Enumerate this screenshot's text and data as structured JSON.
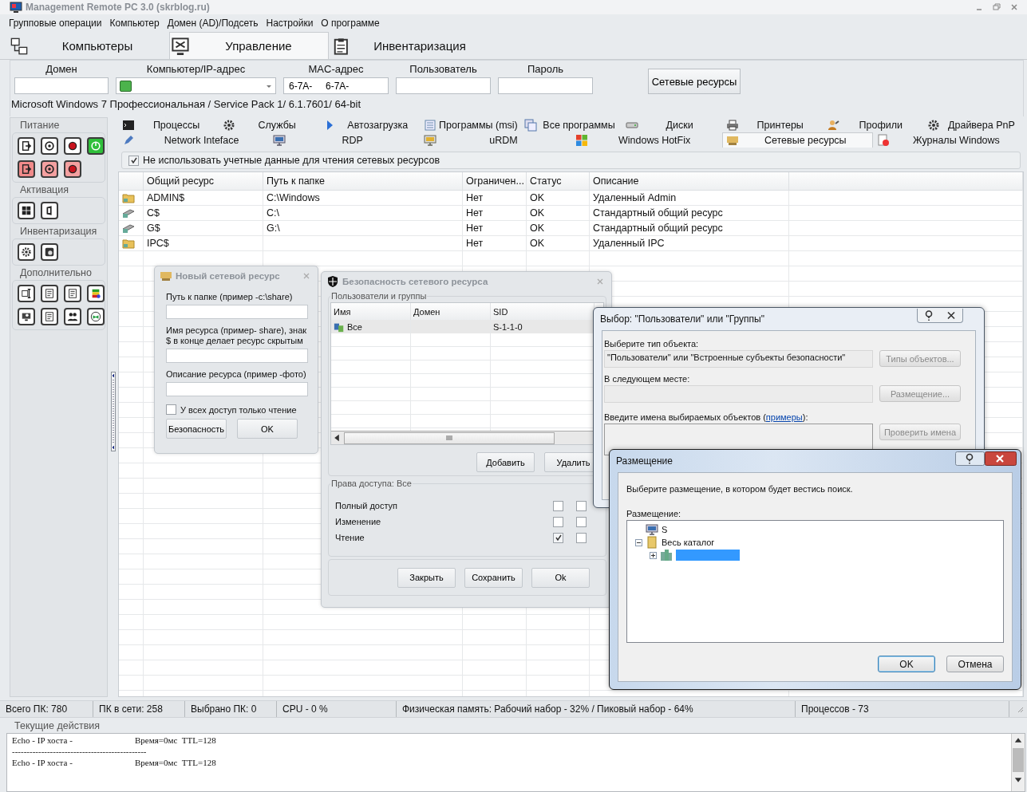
{
  "window": {
    "title": "Management Remote PC 3.0 (skrblog.ru)"
  },
  "menu": [
    "Групповые операции",
    "Компьютер",
    "Домен (AD)/Подсеть",
    "Настройки",
    "О программе"
  ],
  "main_tabs": [
    {
      "label": "Компьютеры",
      "selected": false
    },
    {
      "label": "Управление",
      "selected": true
    },
    {
      "label": "Инвентаризация",
      "selected": false
    }
  ],
  "connection": {
    "fields": [
      {
        "label": "Домен",
        "kind": "text"
      },
      {
        "label": "Компьютер/IP-адрес",
        "kind": "combo"
      },
      {
        "label": "MAC-адрес",
        "kind": "text",
        "value": "6-7A-     6-7A-"
      },
      {
        "label": "Пользователь",
        "kind": "text"
      },
      {
        "label": "Пароль",
        "kind": "text"
      }
    ],
    "button": "Сетевые ресурсы",
    "os_info": "Microsoft Windows 7 Профессиональная / Service Pack 1/ 6.1.7601/ 64-bit"
  },
  "sidebar": [
    {
      "title": "Питание"
    },
    {
      "title": "Активация"
    },
    {
      "title": "Инвентаризация"
    },
    {
      "title": "Дополнительно"
    }
  ],
  "sub_tabs": [
    [
      {
        "label": "Процессы",
        "selected": false
      },
      {
        "label": "Службы",
        "selected": false
      },
      {
        "label": "Автозагрузка",
        "selected": false
      },
      {
        "label": "Программы (msi)",
        "selected": false
      },
      {
        "label": "Все программы",
        "selected": false
      },
      {
        "label": "Диски",
        "selected": false
      },
      {
        "label": "Принтеры",
        "selected": false
      },
      {
        "label": "Профили",
        "selected": false
      },
      {
        "label": "Драйвера PnP",
        "selected": false
      }
    ],
    [
      {
        "label": "Network Inteface",
        "selected": false
      },
      {
        "label": "RDP",
        "selected": false
      },
      {
        "label": "uRDM",
        "selected": false
      },
      {
        "label": "Windows HotFix",
        "selected": false
      },
      {
        "label": "Сетевые ресурсы",
        "selected": true
      },
      {
        "label": "Журналы Windows",
        "selected": false
      }
    ]
  ],
  "option": {
    "label": "Не использовать учетные данные для чтения сетевых ресурсов",
    "checked": true
  },
  "table": {
    "columns": [
      "Общий ресурс",
      "Путь к папке",
      "Ограничен...",
      "Статус",
      "Описание"
    ],
    "rows": [
      {
        "kind": "folder",
        "share": "ADMIN$",
        "path": "C:\\Windows",
        "limit": "Нет",
        "status": "OK",
        "description": "Удаленный Admin"
      },
      {
        "kind": "drive",
        "share": "C$",
        "path": "C:\\",
        "limit": "Нет",
        "status": "OK",
        "description": "Стандартный общий ресурс"
      },
      {
        "kind": "drive",
        "share": "G$",
        "path": "G:\\",
        "limit": "Нет",
        "status": "OK",
        "description": "Стандартный общий ресурс"
      },
      {
        "kind": "folder",
        "share": "IPC$",
        "limit": "Нет",
        "status": "OK",
        "description": "Удаленный IPC"
      }
    ]
  },
  "new_share_dialog": {
    "title": "Новый сетевой ресурс",
    "fields": [
      "Путь к папке (пример -c:\\share)",
      "Имя ресурса (пример- share), знак $ в конце делает ресурс скрытым",
      "Описание ресурса (пример -фото)"
    ],
    "checkbox": {
      "label": "У всех доступ только чтение",
      "checked": false
    },
    "buttons": [
      "Безопасность",
      "OK"
    ]
  },
  "security_dialog": {
    "title": "Безопасность сетевого ресурса",
    "users_group": "Пользователи и группы",
    "columns": [
      "Имя",
      "Домен",
      "SID"
    ],
    "rows": [
      {
        "name": "Все",
        "sid": "S-1-1-0",
        "selected": true
      }
    ],
    "buttons": [
      "Добавить",
      "Удалить"
    ],
    "rights_title": "Права доступа: Все",
    "rights": [
      {
        "label": "Полный доступ",
        "allow": false,
        "deny": false
      },
      {
        "label": "Изменение",
        "allow": false,
        "deny": false
      },
      {
        "label": "Чтение",
        "allow": true,
        "deny": false
      }
    ],
    "footer_buttons": [
      "Закрыть",
      "Сохранить",
      "Ok"
    ]
  },
  "select_dialog": {
    "title": "Выбор: \"Пользователи\" или \"Группы\"",
    "type_label": "Выберите тип объекта:",
    "type_value": "\"Пользователи\" или \"Встроенные субъекты безопасности\"",
    "type_button": "Типы объектов...",
    "location_label": "В следующем месте:",
    "location_button": "Размещение...",
    "names_label": "Введите имена выбираемых объектов (",
    "names_link": "примеры",
    "names_suffix": "):",
    "check_button": "Проверить имена"
  },
  "placement_dialog": {
    "title": "Размещение",
    "prompt": "Выберите размещение, в котором будет вестись поиск.",
    "tree_label": "Размещение:",
    "tree": [
      {
        "kind": "computer",
        "label": "S"
      },
      {
        "kind": "catalog",
        "label": "Весь каталог",
        "expanded": true,
        "children": [
          {
            "kind": "domain",
            "expanded": false,
            "selected": true
          }
        ]
      }
    ],
    "buttons": [
      {
        "label": "OK",
        "default": true
      },
      {
        "label": "Отмена",
        "default": false
      }
    ]
  },
  "status_bar": [
    "Всего ПК: 780",
    "ПК в сети: 258",
    "Выбрано ПК: 0",
    "CPU - 0 %",
    "Физическая память: Рабочий набор - 32% / Пиковый набор - 64%",
    "Процессов - 73"
  ],
  "log": {
    "title": "Текущие действия",
    "lines": [
      {
        "kind": "echo",
        "host": "Echo - IP хоста -",
        "result": "Время=0мс  TTL=128"
      },
      {
        "kind": "separator",
        "text": "----------------------------------------------"
      },
      {
        "kind": "echo",
        "host": "Echo - IP хоста -",
        "result": "Время=0мс  TTL=128"
      }
    ]
  }
}
